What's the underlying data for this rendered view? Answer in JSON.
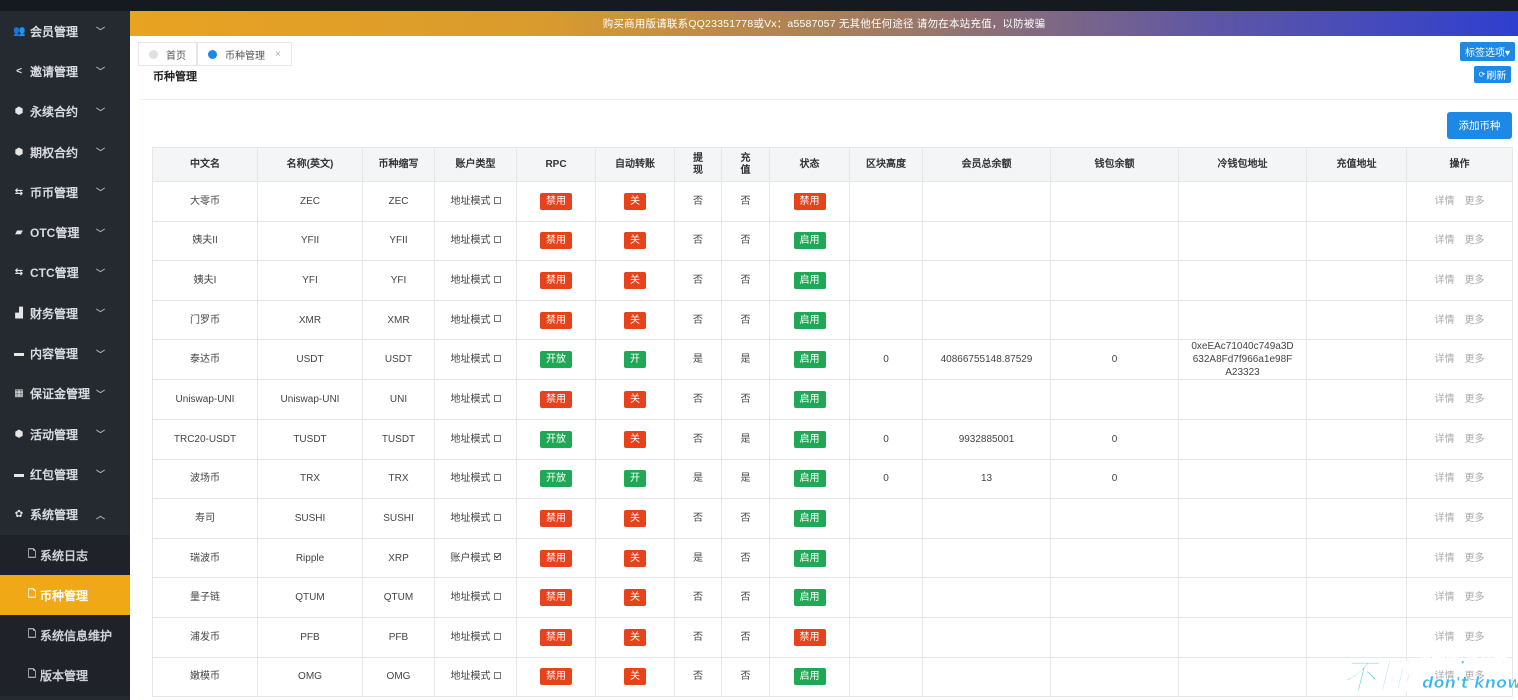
{
  "banner": {
    "text": "购买商用版请联系QQ23351778或Vx：a5587057 无其他任何途径 请勿在本站充值，以防被骗"
  },
  "sidebar": {
    "items": [
      {
        "label": "会员管理",
        "icon": "users-icon"
      },
      {
        "label": "邀请管理",
        "icon": "share-icon"
      },
      {
        "label": "永续合约",
        "icon": "cube-icon"
      },
      {
        "label": "期权合约",
        "icon": "cube-icon"
      },
      {
        "label": "币币管理",
        "icon": "exchange-icon"
      },
      {
        "label": "OTC管理",
        "icon": "briefcase-icon"
      },
      {
        "label": "CTC管理",
        "icon": "exchange-icon"
      },
      {
        "label": "财务管理",
        "icon": "bar-chart-icon"
      },
      {
        "label": "内容管理",
        "icon": "folder-icon"
      },
      {
        "label": "保证金管理",
        "icon": "card-icon"
      },
      {
        "label": "活动管理",
        "icon": "cube-icon"
      },
      {
        "label": "红包管理",
        "icon": "wallet-icon"
      },
      {
        "label": "系统管理",
        "icon": "gear-icon"
      }
    ],
    "sub_items": [
      {
        "label": "系统日志"
      },
      {
        "label": "币种管理"
      },
      {
        "label": "系统信息维护"
      },
      {
        "label": "版本管理"
      }
    ]
  },
  "tabs": [
    {
      "label": "首页"
    },
    {
      "label": "币种管理"
    }
  ],
  "tag_options_label": "标签选项▾",
  "page_title": "币种管理",
  "refresh_label": "刷新",
  "add_label": "添加币种",
  "table": {
    "headers": [
      "中文名",
      "名称(英文)",
      "币种缩写",
      "账户类型",
      "RPC",
      "自动转账",
      "提现",
      "充值",
      "状态",
      "区块高度",
      "会员总余额",
      "钱包余额",
      "冷钱包地址",
      "充值地址",
      "操作"
    ],
    "op_detail": "详情",
    "op_more": "更多",
    "rows": [
      {
        "cn": "大零币",
        "en": "ZEC",
        "abbr": "ZEC",
        "acct": "地址模式",
        "acct_checked": false,
        "rpc": "禁用",
        "auto": "关",
        "wd": "否",
        "dep": "否",
        "status": "禁用",
        "block": "",
        "member_bal": "",
        "wallet_bal": "",
        "cold": "",
        "addr": ""
      },
      {
        "cn": "姨夫II",
        "en": "YFII",
        "abbr": "YFII",
        "acct": "地址模式",
        "acct_checked": false,
        "rpc": "禁用",
        "auto": "关",
        "wd": "否",
        "dep": "否",
        "status": "启用",
        "block": "",
        "member_bal": "",
        "wallet_bal": "",
        "cold": "",
        "addr": ""
      },
      {
        "cn": "姨夫I",
        "en": "YFI",
        "abbr": "YFI",
        "acct": "地址模式",
        "acct_checked": false,
        "rpc": "禁用",
        "auto": "关",
        "wd": "否",
        "dep": "否",
        "status": "启用",
        "block": "",
        "member_bal": "",
        "wallet_bal": "",
        "cold": "",
        "addr": ""
      },
      {
        "cn": "门罗币",
        "en": "XMR",
        "abbr": "XMR",
        "acct": "地址模式",
        "acct_checked": false,
        "rpc": "禁用",
        "auto": "关",
        "wd": "否",
        "dep": "否",
        "status": "启用",
        "block": "",
        "member_bal": "",
        "wallet_bal": "",
        "cold": "",
        "addr": ""
      },
      {
        "cn": "泰达币",
        "en": "USDT",
        "abbr": "USDT",
        "acct": "地址模式",
        "acct_checked": false,
        "rpc": "开放",
        "auto": "开",
        "wd": "是",
        "dep": "是",
        "status": "启用",
        "block": "0",
        "member_bal": "40866755148.87529",
        "wallet_bal": "0",
        "cold": "0xeEAc71040c749a3D632A8Fd7f966a1e98FA23323",
        "addr": ""
      },
      {
        "cn": "Uniswap-UNI",
        "en": "Uniswap-UNI",
        "abbr": "UNI",
        "acct": "地址模式",
        "acct_checked": false,
        "rpc": "禁用",
        "auto": "关",
        "wd": "否",
        "dep": "否",
        "status": "启用",
        "block": "",
        "member_bal": "",
        "wallet_bal": "",
        "cold": "",
        "addr": ""
      },
      {
        "cn": "TRC20-USDT",
        "en": "TUSDT",
        "abbr": "TUSDT",
        "acct": "地址模式",
        "acct_checked": false,
        "rpc": "开放",
        "auto": "关",
        "wd": "否",
        "dep": "是",
        "status": "启用",
        "block": "0",
        "member_bal": "9932885001",
        "wallet_bal": "0",
        "cold": "",
        "addr": ""
      },
      {
        "cn": "波场币",
        "en": "TRX",
        "abbr": "TRX",
        "acct": "地址模式",
        "acct_checked": false,
        "rpc": "开放",
        "auto": "开",
        "wd": "是",
        "dep": "是",
        "status": "启用",
        "block": "0",
        "member_bal": "13",
        "wallet_bal": "0",
        "cold": "",
        "addr": ""
      },
      {
        "cn": "寿司",
        "en": "SUSHI",
        "abbr": "SUSHI",
        "acct": "地址模式",
        "acct_checked": false,
        "rpc": "禁用",
        "auto": "关",
        "wd": "否",
        "dep": "否",
        "status": "启用",
        "block": "",
        "member_bal": "",
        "wallet_bal": "",
        "cold": "",
        "addr": ""
      },
      {
        "cn": "瑞波币",
        "en": "Ripple",
        "abbr": "XRP",
        "acct": "账户模式",
        "acct_checked": true,
        "rpc": "禁用",
        "auto": "关",
        "wd": "是",
        "dep": "否",
        "status": "启用",
        "block": "",
        "member_bal": "",
        "wallet_bal": "",
        "cold": "",
        "addr": ""
      },
      {
        "cn": "量子链",
        "en": "QTUM",
        "abbr": "QTUM",
        "acct": "地址模式",
        "acct_checked": false,
        "rpc": "禁用",
        "auto": "关",
        "wd": "否",
        "dep": "否",
        "status": "启用",
        "block": "",
        "member_bal": "",
        "wallet_bal": "",
        "cold": "",
        "addr": ""
      },
      {
        "cn": "浦发币",
        "en": "PFB",
        "abbr": "PFB",
        "acct": "地址模式",
        "acct_checked": false,
        "rpc": "禁用",
        "auto": "关",
        "wd": "否",
        "dep": "否",
        "status": "禁用",
        "block": "",
        "member_bal": "",
        "wallet_bal": "",
        "cold": "",
        "addr": ""
      },
      {
        "cn": "嫩模币",
        "en": "OMG",
        "abbr": "OMG",
        "acct": "地址模式",
        "acct_checked": false,
        "rpc": "禁用",
        "auto": "关",
        "wd": "否",
        "dep": "否",
        "status": "启用",
        "block": "",
        "member_bal": "",
        "wallet_bal": "",
        "cold": "",
        "addr": ""
      }
    ]
  },
  "watermark": {
    "big": "不懂",
    "line1": "爱帮助·爱分享",
    "line2": "don't know"
  },
  "colors": {
    "accent": "#1e88e5",
    "active_menu": "#f0a817",
    "danger": "#e8421c",
    "success": "#1fa855",
    "sidebar_bg": "#252930"
  }
}
